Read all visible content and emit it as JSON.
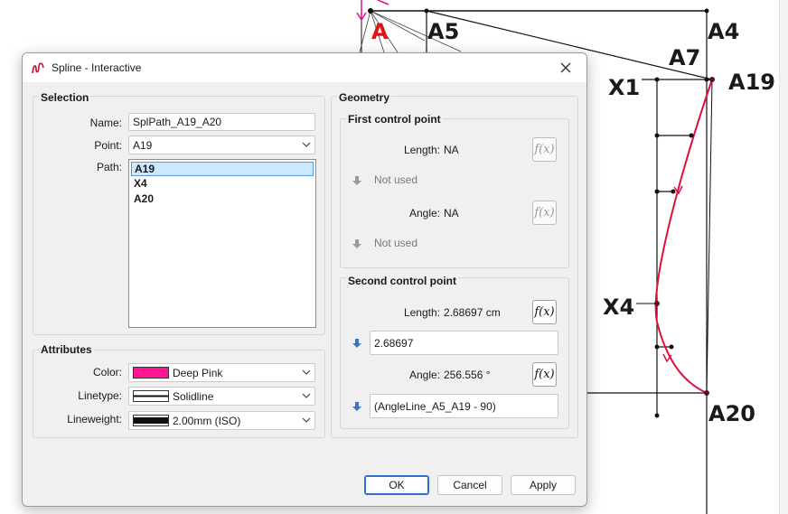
{
  "canvas": {
    "labels": {
      "A": "A",
      "A5": "A5",
      "A4": "A4",
      "A7": "A7",
      "A19": "A19",
      "X1": "X1",
      "X4": "X4",
      "A20": "A20"
    },
    "spline_color": "#e0103a"
  },
  "dialog": {
    "title": "Spline - Interactive",
    "icons": {
      "app": "spline-app-icon",
      "close": "close-icon"
    },
    "selection": {
      "title": "Selection",
      "name_label": "Name:",
      "name_value": "SplPath_A19_A20",
      "point_label": "Point:",
      "point_value": "A19",
      "path_label": "Path:",
      "path_items": [
        "A19",
        "X4",
        "A20"
      ]
    },
    "attributes": {
      "title": "Attributes",
      "color_label": "Color:",
      "color_value": "Deep Pink",
      "color_hex": "#ff1493",
      "linetype_label": "Linetype:",
      "linetype_value": "Solidline",
      "lineweight_label": "Lineweight:",
      "lineweight_value": "2.00mm (ISO)"
    },
    "geometry": {
      "title": "Geometry",
      "first": {
        "title": "First control point",
        "length_label": "Length:",
        "length_value": "NA",
        "length_formula": "Not used",
        "angle_label": "Angle:",
        "angle_value": "NA",
        "angle_formula": "Not used"
      },
      "second": {
        "title": "Second control point",
        "length_label": "Length:",
        "length_value": "2.68697 cm",
        "length_formula": "2.68697",
        "angle_label": "Angle:",
        "angle_value": "256.556 °",
        "angle_formula": "(AngleLine_A5_A19 - 90)"
      },
      "fx_label": "f(x)"
    },
    "buttons": {
      "ok": "OK",
      "cancel": "Cancel",
      "apply": "Apply"
    }
  }
}
